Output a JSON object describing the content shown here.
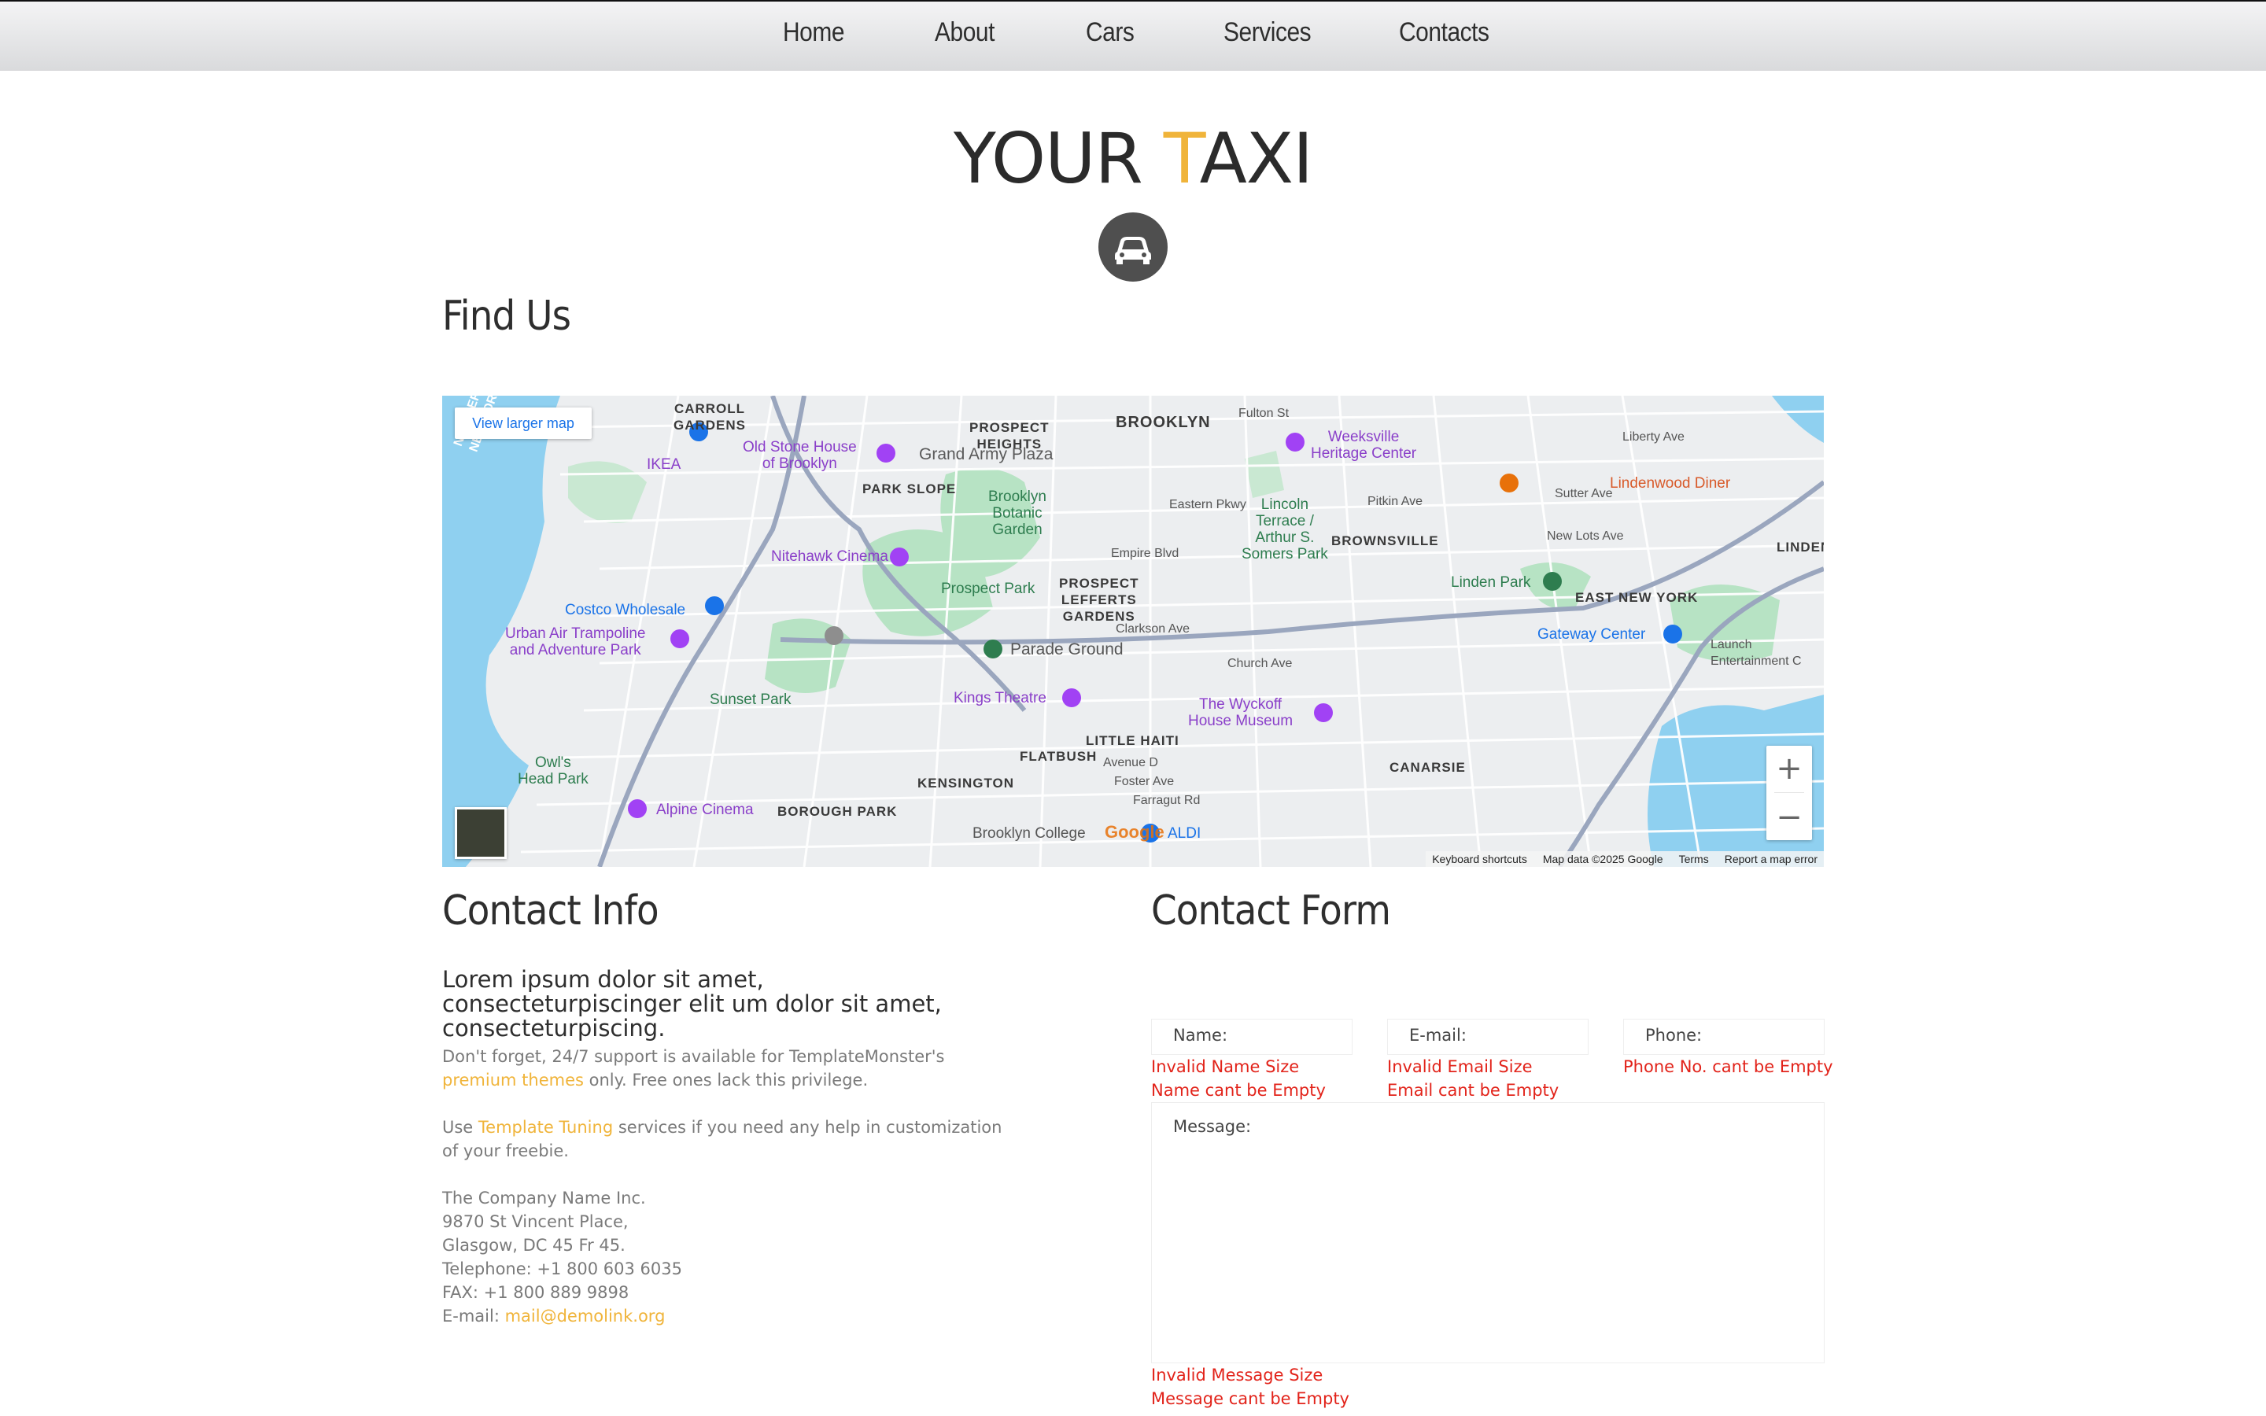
{
  "nav": {
    "items": [
      "Home",
      "About",
      "Cars",
      "Services",
      "Contacts"
    ]
  },
  "logo": {
    "part1": "YOUR ",
    "accent": "T",
    "part2": "AXI",
    "accent_color": "#f0b43a"
  },
  "find_us": {
    "title": "Find Us",
    "map": {
      "view_larger": "View larger map",
      "zoom_in": "+",
      "zoom_out": "−",
      "google": "Google",
      "footer": [
        "Keyboard shortcuts",
        "Map data ©2025 Google",
        "Terms",
        "Report a map error"
      ],
      "labels": {
        "carroll": "CARROLL\nGARDENS",
        "prospect_heights": "PROSPECT\nHEIGHTS",
        "brooklyn": "BROOKLYN",
        "fulton": "Fulton St",
        "weeksville": "Weeksville\nHeritage Center",
        "ikea": "IKEA",
        "old_stone": "Old Stone House\nof Brooklyn",
        "grand_army": "Grand Army Plaza",
        "park_slope": "PARK SLOPE",
        "botanic": "Brooklyn\nBotanic\nGarden",
        "lincoln": "Lincoln\nTerrace /\nArthur S.\nSomers Park",
        "brownsville": "BROWNSVILLE",
        "lindenwood": "Lindenwood Diner",
        "nitehawk": "Nitehawk Cinema",
        "prospect_park": "Prospect Park",
        "lefferts": "PROSPECT\nLEFFERTS\nGARDENS",
        "linden_park": "Linden Park",
        "east_ny": "EAST NEW YORK",
        "costco": "Costco Wholesale",
        "urban_air": "Urban Air Trampoline\nand Adventure Park",
        "parade": "Parade Ground",
        "gateway": "Gateway Center",
        "launch": "Launch\nEntertainment C",
        "sunset": "Sunset Park",
        "kings": "Kings Theatre",
        "wyckoff": "The Wyckoff\nHouse Museum",
        "little_haiti": "LITTLE HAITI",
        "flatbush": "FLATBUSH",
        "owls": "Owl's\nHead Park",
        "kensington": "KENSINGTON",
        "canarsie": "CANARSIE",
        "alpine": "Alpine Cinema",
        "borough": "BOROUGH PARK",
        "bklyn_college": "Brooklyn College",
        "aldi": "ALDI",
        "nj_ny": "NEW JERSEY\nNEW YORK",
        "linden_trunc": "LINDENW",
        "empire": "Empire Blvd",
        "clarkson": "Clarkson Ave",
        "church": "Church Ave",
        "foster": "Foster Ave",
        "farragut": "Farragut Rd",
        "avenue_d": "Avenue D",
        "pitkin": "Pitkin Ave",
        "sutter": "Sutter Ave",
        "liberty": "Liberty Ave",
        "new_lots": "New Lots Ave",
        "eastern_pkwy": "Eastern Pkwy"
      }
    }
  },
  "contact_info": {
    "title": "Contact Info",
    "lead": "Lorem ipsum dolor sit amet, consecteturpiscinger elit um dolor sit amet, consecteturpiscing.",
    "p1_before": "Don't forget, 24/7 support is available for TemplateMonster's ",
    "p1_link": "premium themes",
    "p1_after": " only. Free ones lack this privilege.",
    "p2_before": "Use ",
    "p2_link": "Template Tuning",
    "p2_after": " services if you need any help in customization of your freebie.",
    "address": [
      "The Company Name Inc.",
      "9870 St Vincent Place,",
      "Glasgow, DC 45 Fr 45.",
      "Telephone: +1 800 603 6035",
      "FAX: +1 800 889 9898"
    ],
    "email_label": "E-mail: ",
    "email": "mail@demolink.org"
  },
  "contact_form": {
    "title": "Contact Form",
    "name_placeholder": "Name:",
    "email_placeholder": "E-mail:",
    "phone_placeholder": "Phone:",
    "message_placeholder": "Message:",
    "errors": {
      "name_size": "Invalid Name Size",
      "name_empty": "Name cant be Empty",
      "email_size": "Invalid Email Size",
      "email_empty": "Email cant be Empty",
      "phone_empty": "Phone No. cant be Empty",
      "message_size": "Invalid Message Size",
      "message_empty": "Message cant be Empty"
    },
    "error_color": "#e2231a"
  }
}
